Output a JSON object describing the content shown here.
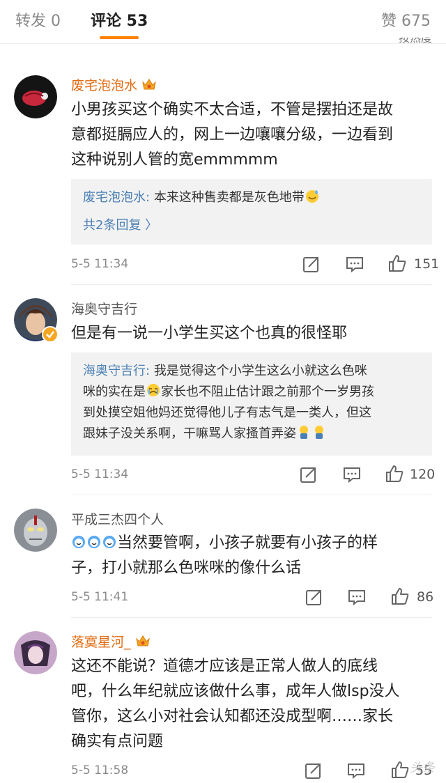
{
  "tabs": {
    "repost_label": "转发 0",
    "comments_label": "评论 53",
    "likes_label": "赞 675"
  },
  "sort_label": "按热度",
  "watermark": "头条",
  "comments": [
    {
      "username": "废宅泡泡水",
      "text_lines": [
        "小男孩买这个确实不太合适，不管是摆拍还是故",
        "意都挺膈应人的，网上一边嚷嚷分级，一边看到",
        "这种说别人管的宽emmmmm"
      ],
      "reply": {
        "name": "废宅泡泡水:",
        "lines": [
          "本来这种售卖都是灰色地带"
        ],
        "more": "共2条回复 〉"
      },
      "time": "5-5 11:34",
      "likes": "151"
    },
    {
      "username": "海奥守吉行",
      "text_lines": [
        "但是有一说一小学生买这个也真的很怪耶"
      ],
      "reply": {
        "name": "海奥守吉行:",
        "lines": [
          "我是觉得这个小学生这么小就这么色咪",
          "咪的实在是",
          "家长也不阻止估计跟之前那个一岁男孩",
          "到处摸空姐他妈还觉得他儿子有志气是一类人，但这",
          "跟妹子没关系啊，干嘛骂人家搔首弄姿"
        ]
      },
      "time": "5-5 11:34",
      "likes": "120"
    },
    {
      "username": "平成三杰四个人",
      "text_lines": [
        "当然要管啊，小孩子就要有小孩子的样",
        "子，打小就那么色咪咪的像什么话"
      ],
      "time": "5-5 11:41",
      "likes": "86"
    },
    {
      "username": "落寞星河_",
      "text_lines": [
        "这还不能说？道德才应该是正常人做人的底线",
        "吧，什么年纪就应该做什么事，成年人做lsp没人",
        "管你，这么小对社会认知都还没成型啊……家长",
        "确实有点问题"
      ],
      "time": "5-5 11:58",
      "likes": "55"
    }
  ],
  "colors": {
    "accent": "#ff8200",
    "vip_name": "#e36a10",
    "link": "#4a7fb5"
  }
}
